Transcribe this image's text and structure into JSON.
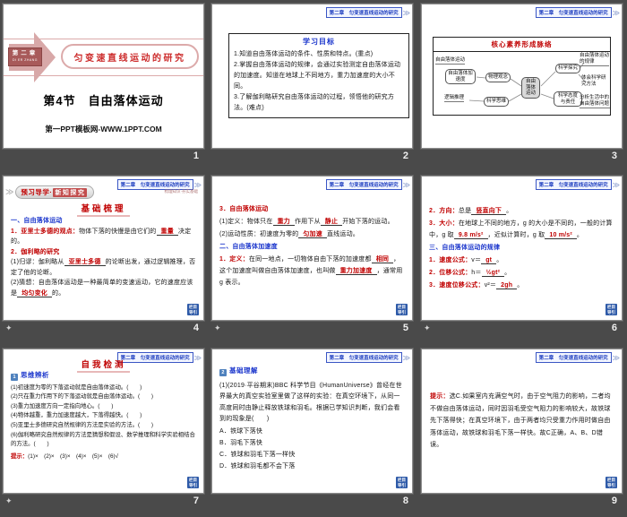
{
  "colors": {
    "background": "#4a4a4a",
    "accent_red": "#c00000",
    "section_blue": "#1a35cc",
    "header_blue": "#1f3fc0",
    "tag_blue": "#2e5aa8",
    "slide1_dark_red": "#a85a5a",
    "slide1_pink": "#d8a8a8"
  },
  "view": {
    "star_icon": "✦",
    "ribbon_chevron": "≫",
    "header": {
      "text": "第二章　匀变速直线运动的研究",
      "chevron": "≫"
    },
    "corner_tag": {
      "line1": "栏目",
      "line2": "导引"
    }
  },
  "slide1": {
    "number": "1",
    "badge_title": "第二章",
    "badge_sub": "DI ER ZHANG",
    "banner": "匀变速直线运动的研究",
    "title": "第4节　自由落体运动",
    "footer": "第一PPT模板网-WWW.1PPT.COM"
  },
  "slide2": {
    "number": "2",
    "box_title": "学习目标",
    "items": [
      "1.知道自由落体运动的条件、性质和特点。(重点)",
      "2.掌握自由落体运动的规律，会通过实验测定自由落体运动的加速度。知道在地球上不同地方，重力加速度的大小不同。",
      "3.了解伽利略研究自由落体运动的过程，领悟他的研究方法。(难点)"
    ]
  },
  "slide3": {
    "number": "3",
    "title": "核心素养形成脉络",
    "left_text1": "自由落体运动",
    "left_text2": "自由落体加速度",
    "left_text3": "逻辑推理",
    "node_concept": "物理观念",
    "node_thinking": "科学思维",
    "center": "自由落体运动",
    "node_inquiry": "科学探究",
    "node_attitude": "科学态度与责任",
    "right_text1": "自由落体运动的规律",
    "right_text2": "体会科学研究方法",
    "right_text3": "分析生活中的自由落体问题"
  },
  "slide4": {
    "number": "4",
    "ribbon_pre": "预习导学·",
    "ribbon_hl": "新知探究",
    "ribbon_right": "梳理知识·夯实基础",
    "section_title": "基础梳理",
    "sec1": "一、自由落体运动",
    "p1_label": "1．亚里士多德的观点：",
    "p1_a": "物体下落的快慢是由它们的",
    "p1_blank": "重量",
    "p1_b": "决定的。",
    "p2_label": "2．伽利略的研究",
    "p3_a": "(1)归谬：伽利略从",
    "p3_blank": "亚里士多德",
    "p3_b": "的论断出发，通过逻辑推理，否定了他的论断。",
    "p4_a": "(2)猜想：自由落体运动是一种最简单的变速运动，它的速度应该是",
    "p4_blank": "均匀变化",
    "p4_b": "的。"
  },
  "slide5": {
    "number": "5",
    "h1": "3．自由落体运动",
    "p1_a": "(1)定义：物体只在",
    "p1_blank1": "重力",
    "p1_b": "作用下从",
    "p1_blank2": "静止",
    "p1_c": "开始下落的运动。",
    "p2_a": "(2)运动性质：初速度为零的",
    "p2_blank": "匀加速",
    "p2_b": "直线运动。",
    "sec": "二、自由落体加速度",
    "p3_label": "1．定义：",
    "p3_a": "在同一地点，一切物体自由下落的加速度都",
    "p3_blank1": "相同",
    "p3_b": "，这个加速度叫做自由落体加速度，也叫做",
    "p3_blank2": "重力加速度",
    "p3_c": "，通常用 g 表示。"
  },
  "slide6": {
    "number": "6",
    "p1_label": "2．方向：",
    "p1_a": "总是",
    "p1_blank": "竖直向下",
    "p1_b": "。",
    "p2_label": "3．大小：",
    "p2_a": "在地球上不同的地方，g 的大小是不同的，一般的计算中，g 取",
    "p2_blank1": "9.8 m/s²",
    "p2_b": "，近似计算时，g 取",
    "p2_blank2": "10 m/s²",
    "p2_c": "。",
    "sec": "三、自由落体运动的规律",
    "f1_label": "1．速度公式：",
    "f1_a": "v＝",
    "f1_blank": "gt",
    "f1_b": "。",
    "f2_label": "2．位移公式：",
    "f2_a": "h＝",
    "f2_blank": "½gt²",
    "f2_b": "。",
    "f3_label": "3．速度位移公式：",
    "f3_a": "v²＝",
    "f3_blank": "2gh",
    "f3_b": "。"
  },
  "slide7": {
    "number": "7",
    "section_title": "自我检测",
    "badge": "1",
    "heading": "思维辨析",
    "items": [
      "(1)初速度为零的下落运动就是自由落体运动。(　　)",
      "(2)只在重力作用下的下落运动就是自由落体运动。(　　)",
      "(3)重力加速度方向一定指向地心。(　　)",
      "(4)物体越重，重力加速度越大，下落得越快。(　　)",
      "(5)亚里士多德研究自然规律的方法是实验的方法。(　　)",
      "(6)伽利略研究自然规律的方法是猜想和假设、数学推理和科学实验相结合的方法。(　　)"
    ],
    "hint_label": "提示：",
    "hint": "(1)×　(2)×　(3)×　(4)×　(5)×　(6)√"
  },
  "slide8": {
    "number": "8",
    "badge": "2",
    "heading": "基础理解",
    "stem": "(1)(2019·平谷期末)BBC 科学节目《HumanUniverse》曾经在世界最大的真空实验室里做了这样的实验：在真空环境下，从同一高度同时由静止释放铁球和羽毛。根据已学知识判断，我们会看到的现象是(　　)",
    "options": [
      "A．铁球下落快",
      "B．羽毛下落快",
      "C．铁球和羽毛下落一样快",
      "D．铁球和羽毛都不会下落"
    ]
  },
  "slide9": {
    "number": "9",
    "hint_label": "提示：",
    "hint": "选C.如果室内充满空气时，由于空气阻力的影响，二者均不做自由落体运动，同时因羽毛受空气阻力的影响较大，故铁球先下落得快；在真空环境下，由于两者均只受重力作用时做自由落体运动，故铁球和羽毛下落一样快。故C正确，A、B、D错误。"
  }
}
